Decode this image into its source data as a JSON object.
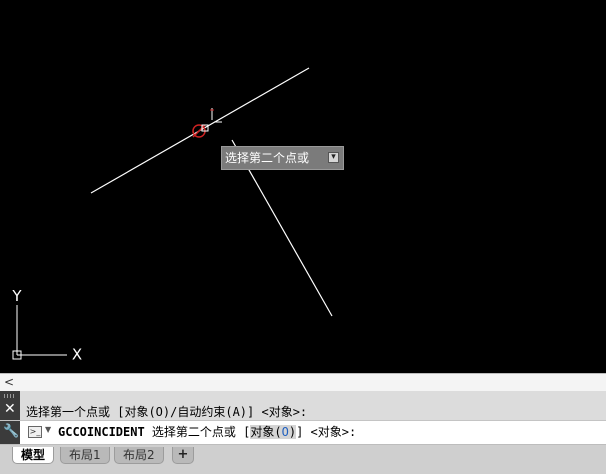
{
  "drawing": {
    "tooltip_text": "选择第二个点或",
    "ucs_y_label": "Y",
    "ucs_x_label": "X"
  },
  "command": {
    "history_line": "选择第一个点或 [对象(O)/自动约束(A)] <对象>:",
    "command_name": "GCCOINCIDENT",
    "prompt_text": " 选择第二个点或 [",
    "option_prefix": "对象(",
    "option_key": "O",
    "option_suffix": ")",
    "prompt_tail": "] <对象>:"
  },
  "tabs": {
    "model": "模型",
    "layout1": "布局1",
    "layout2": "布局2",
    "add": "+"
  },
  "icons": {
    "scroll_left": "chevron-left-icon",
    "close": "close-icon",
    "customize": "wrench-icon",
    "prompt": "command-prompt-icon"
  },
  "colors": {
    "canvas_background": "#000000",
    "line_color": "#ffffff",
    "marker_color": "#cc2222"
  }
}
